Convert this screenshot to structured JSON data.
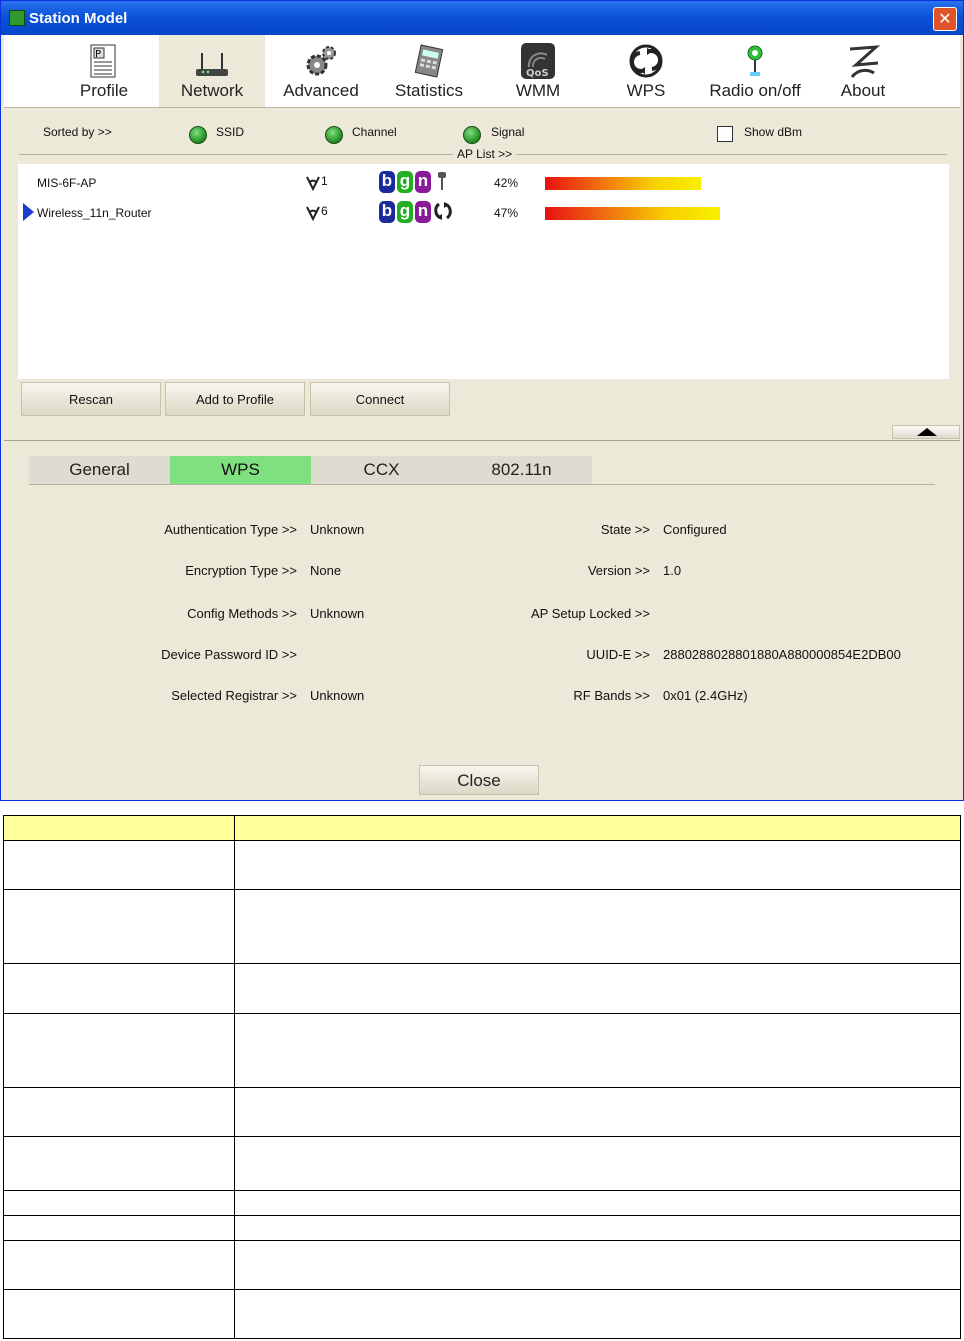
{
  "window": {
    "title": "Station Model",
    "close_glyph": "✕"
  },
  "toolbar": [
    {
      "label": "Profile",
      "icon": "profile-icon"
    },
    {
      "label": "Network",
      "icon": "network-icon",
      "active": true
    },
    {
      "label": "Advanced",
      "icon": "advanced-icon"
    },
    {
      "label": "Statistics",
      "icon": "statistics-icon"
    },
    {
      "label": "WMM",
      "icon": "wmm-icon"
    },
    {
      "label": "WPS",
      "icon": "wps-icon"
    },
    {
      "label": "Radio on/off",
      "icon": "radio-icon"
    },
    {
      "label": "About",
      "icon": "about-icon"
    }
  ],
  "sort": {
    "label": "Sorted by >>",
    "ssid": "SSID",
    "channel": "Channel",
    "signal": "Signal",
    "show_dbm": "Show dBm",
    "ap_list": "AP List >>"
  },
  "ap_list": [
    {
      "ssid": "MIS-6F-AP",
      "channel": "1",
      "modes": [
        "b",
        "g",
        "n"
      ],
      "security": "key",
      "signal": "42%",
      "signal_value": 42,
      "selected": false
    },
    {
      "ssid": "Wireless_11n_Router",
      "channel": "6",
      "modes": [
        "b",
        "g",
        "n"
      ],
      "security": "wps",
      "signal": "47%",
      "signal_value": 47,
      "selected": true
    }
  ],
  "buttons": {
    "rescan": "Rescan",
    "add_to_profile": "Add to Profile",
    "connect": "Connect",
    "close": "Close"
  },
  "detail_tabs": [
    "General",
    "WPS",
    "CCX",
    "802.11n"
  ],
  "active_tab": "WPS",
  "wps_left": [
    {
      "label": "Authentication Type >>",
      "value": "Unknown"
    },
    {
      "label": "Encryption Type >>",
      "value": "None"
    },
    {
      "label": "Config Methods >>",
      "value": "Unknown"
    },
    {
      "label": "Device Password ID >>",
      "value": ""
    },
    {
      "label": "Selected Registrar >>",
      "value": "Unknown"
    }
  ],
  "wps_right": [
    {
      "label": "State >>",
      "value": "Configured"
    },
    {
      "label": "Version >>",
      "value": "1.0"
    },
    {
      "label": "AP Setup Locked >>",
      "value": ""
    },
    {
      "label": "UUID-E >>",
      "value": "2880288028801880A880000854E2DB00"
    },
    {
      "label": "RF Bands >>",
      "value": "0x01 (2.4GHz)"
    }
  ],
  "colors": {
    "accent_green": "#7fe07f",
    "titlebar_blue": "#0a52d8",
    "table_header": "#ffff99"
  }
}
